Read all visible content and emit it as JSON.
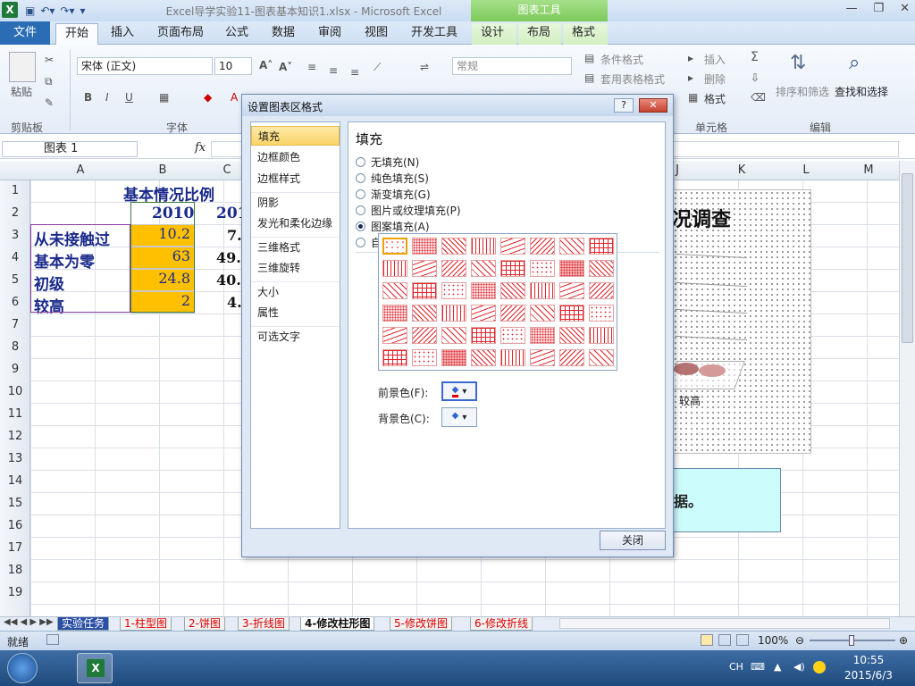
{
  "window": {
    "title": "Excel导学实验11-图表基本知识1.xlsx - Microsoft Excel",
    "chart_tools": "图表工具"
  },
  "tabs": [
    {
      "label": "文件"
    },
    {
      "label": "开始"
    },
    {
      "label": "插入"
    },
    {
      "label": "页面布局"
    },
    {
      "label": "公式"
    },
    {
      "label": "数据"
    },
    {
      "label": "审阅"
    },
    {
      "label": "视图"
    },
    {
      "label": "开发工具"
    },
    {
      "label": "设计"
    },
    {
      "label": "布局"
    },
    {
      "label": "格式"
    }
  ],
  "ribbon": {
    "paste": "粘贴",
    "clipboard": "剪贴板",
    "font_group": "字体",
    "font_name": "宋体 (正文)",
    "font_size": "10",
    "bold": "B",
    "italic": "I",
    "underline": "U",
    "number_format": "常规",
    "cond_format": "条件格式",
    "table_format": "套用表格格式",
    "insert": "插入",
    "delete": "删除",
    "format": "格式",
    "cells_group": "单元格",
    "sort_filter": "排序和筛选",
    "find_select": "查找和选择",
    "edit_group": "编辑",
    "sigma": "Σ"
  },
  "formula_bar": {
    "name_box": "图表 1",
    "fx": "fx"
  },
  "columns": [
    "A",
    "B",
    "C",
    "J",
    "K",
    "L",
    "M"
  ],
  "rows": [
    "1",
    "2",
    "3",
    "4",
    "5",
    "6",
    "7",
    "8",
    "9",
    "10",
    "11",
    "12",
    "13",
    "14",
    "15",
    "16",
    "17",
    "18",
    "19"
  ],
  "sheet": {
    "title": "基本情况比例",
    "header_2010": "2010",
    "header_c": "201",
    "labels": [
      "从未接触过",
      "基本为零",
      "初级",
      "较高"
    ],
    "b_values": [
      "10.2",
      "63",
      "24.8",
      "2"
    ],
    "c_values": [
      "7.",
      "49.",
      "40.",
      "4."
    ]
  },
  "chart": {
    "title_fragment": "况调查",
    "category_label": "较高"
  },
  "note_fragment": "据。",
  "dialog": {
    "title": "设置图表区格式",
    "help": "?",
    "close_x": "✕",
    "nav": [
      "填充",
      "边框颜色",
      "边框样式",
      "阴影",
      "发光和柔化边缘",
      "三维格式",
      "三维旋转",
      "大小",
      "属性",
      "可选文字"
    ],
    "selected_nav": "填充",
    "pane_title": "填充",
    "fill_options": [
      "无填充(N)",
      "纯色填充(S)",
      "渐变填充(G)",
      "图片或纹理填充(P)",
      "图案填充(A)",
      "自动(U)"
    ],
    "selected_fill": "图案填充(A)",
    "foreground": "前景色(F):",
    "background": "背景色(C):",
    "close_button": "关闭"
  },
  "sheet_tabs": [
    "实验任务",
    "1-柱型图",
    "2-饼图",
    "3-折线图",
    "4-修改柱形图",
    "5-修改饼图",
    "6-修改折线"
  ],
  "active_sheet": "4-修改柱形图",
  "status": {
    "ready": "就绪",
    "zoom": "100%"
  },
  "taskbar": {
    "lang": "CH",
    "time": "10:55",
    "date": "2015/6/3"
  },
  "colors": {
    "accent": "#2a6db5",
    "pattern_red": "#e0232b",
    "cell_highlight": "#fec000"
  }
}
